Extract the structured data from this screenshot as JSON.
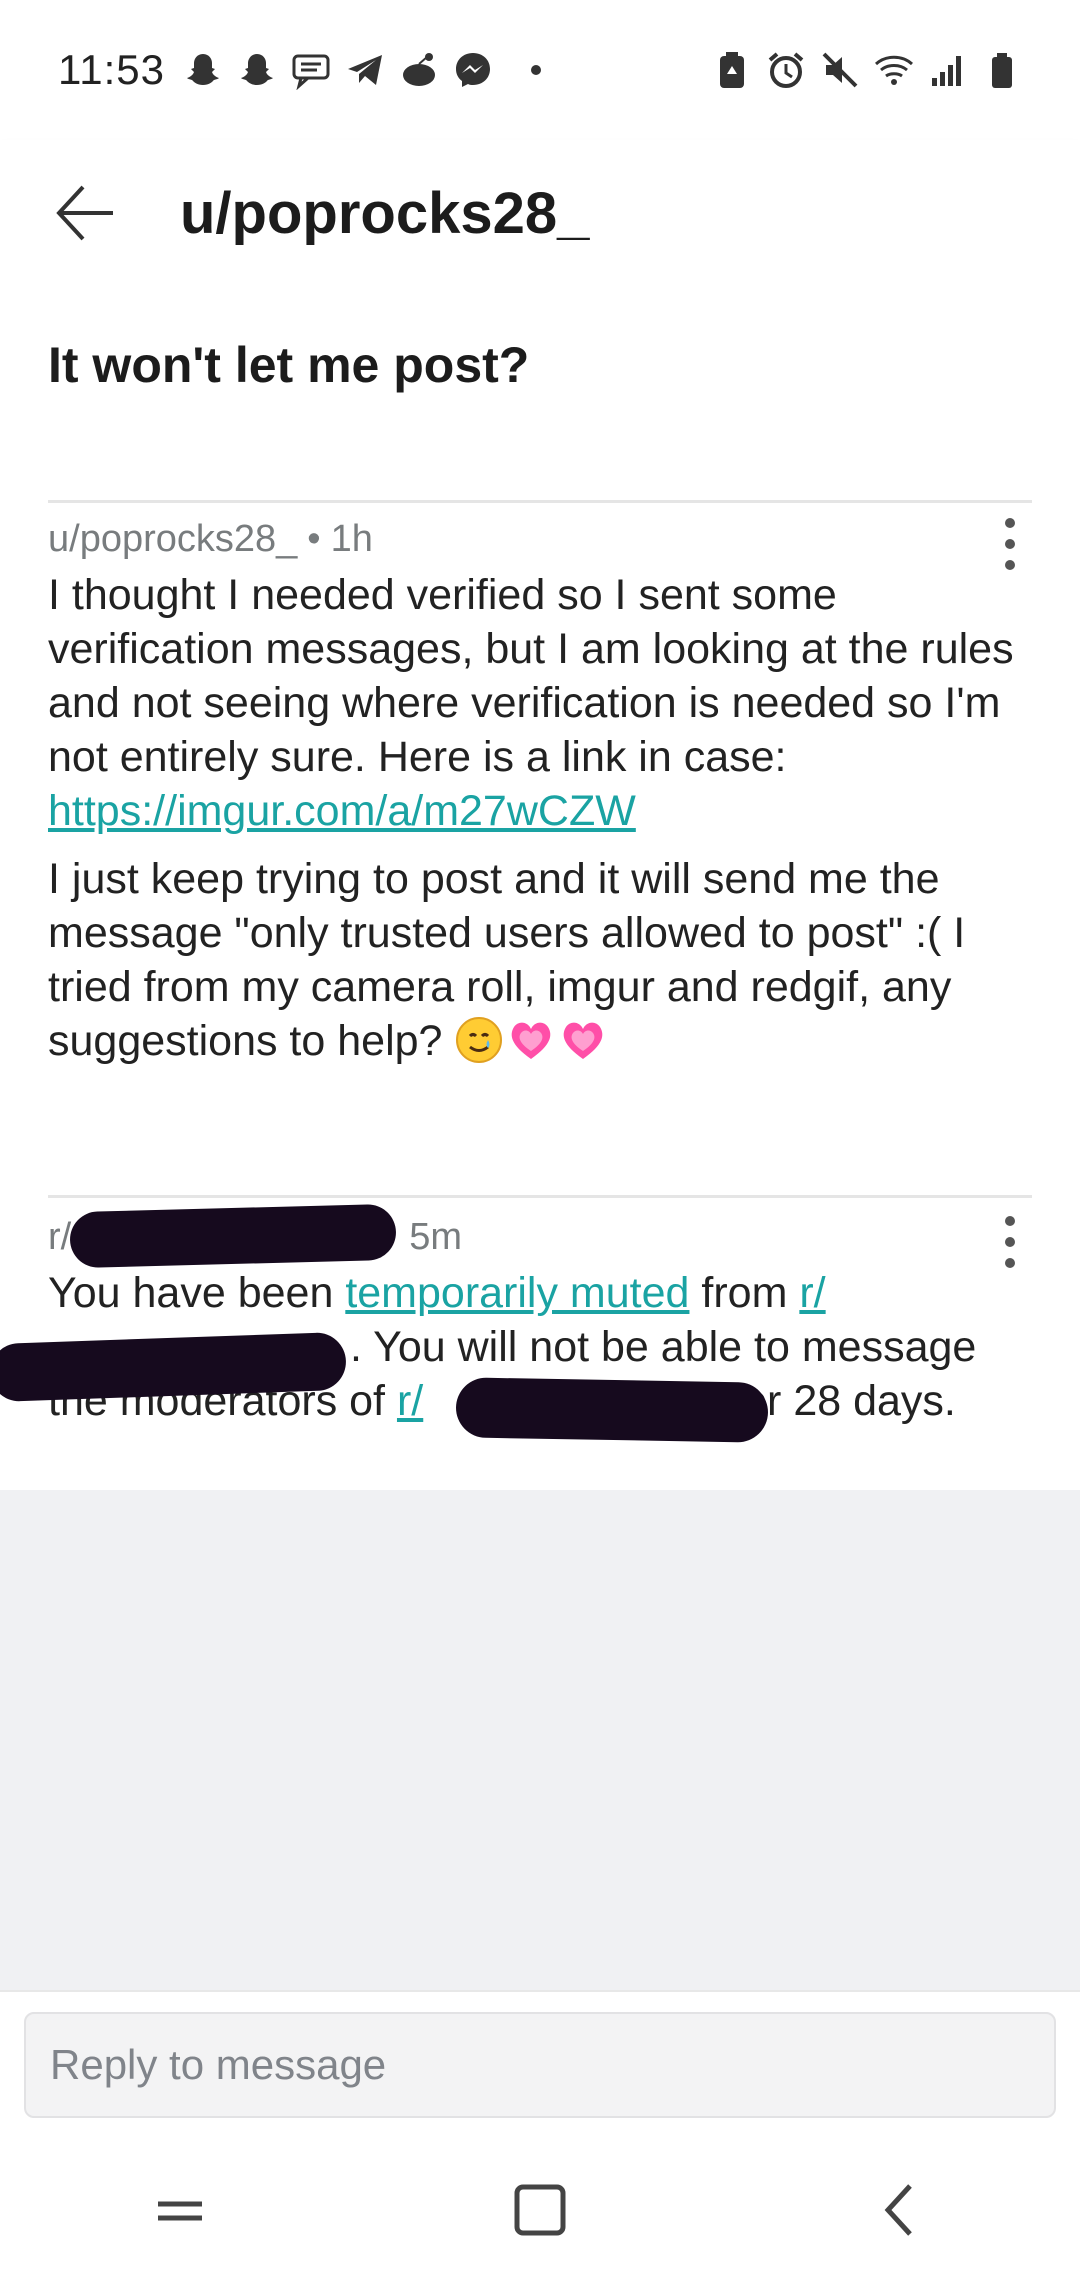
{
  "status_bar": {
    "time": "11:53",
    "left_icons": [
      "snapchat-icon",
      "snapchat-icon",
      "message-icon",
      "telegram-icon",
      "reddit-icon",
      "messenger-icon",
      "dot-icon"
    ],
    "right_icons": [
      "battery-saver-icon",
      "alarm-icon",
      "mute-icon",
      "wifi-icon",
      "signal-icon",
      "battery-icon"
    ]
  },
  "app_bar": {
    "title": "u/poprocks28_",
    "back_icon": "arrow-left-icon"
  },
  "thread": {
    "title": "It won't let me post?"
  },
  "messages": [
    {
      "author": "u/poprocks28_",
      "separator": "•",
      "time": "1h",
      "paragraph1_text": "I thought I needed verified so I sent some verification messages, but I am looking at the rules and not seeing where verification is needed so I'm not entirely sure. Here is a link in case: ",
      "paragraph1_link": "https://imgur.com/a/m27wCZW",
      "paragraph2_text": "I just keep trying to post and it will send me the message \"only trusted users allowed to post\" :( I tried from my camera roll, imgur and redgif, any suggestions to help? ",
      "emojis": [
        "smiling-face-with-tear-icon",
        "growing-heart-icon",
        "growing-heart-icon"
      ]
    },
    {
      "author_prefix": "r/",
      "time": "5m",
      "text_before_link": "You have been ",
      "link1": "temporarily muted",
      "text_from": " from ",
      "link2": "r/",
      "text_after": ". You will not be able to message",
      "line3_prefix": "the moderators of ",
      "link3": "r/",
      "line3_suffix": " for 28 days."
    }
  ],
  "reply": {
    "placeholder": "Reply to message"
  },
  "nav_bar": {
    "icons": [
      "recent-apps-icon",
      "home-icon",
      "back-icon"
    ]
  },
  "colors": {
    "link": "#1aa3a3",
    "redaction": "#160a1e",
    "grey_background": "#f0f1f3"
  }
}
